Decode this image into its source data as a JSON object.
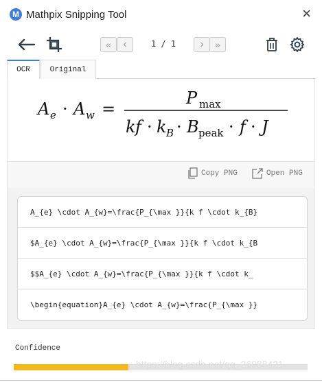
{
  "window": {
    "title": "Mathpix Snipping Tool",
    "close_glyph": "×"
  },
  "toolbar": {
    "back_icon": "arrow-left-icon",
    "crop_icon": "screen-capture-icon",
    "first_page_glyph": "«",
    "prev_page_glyph": "‹",
    "next_page_glyph": "›",
    "last_page_glyph": "»",
    "page_indicator": "1 / 1",
    "delete_icon": "trash-icon",
    "settings_icon": "gear-icon"
  },
  "tabs": [
    {
      "label": "OCR",
      "active": true
    },
    {
      "label": "Original",
      "active": false
    }
  ],
  "preview": {
    "lhs": {
      "A1": "A",
      "e": "e",
      "A2": "A",
      "w": "w",
      "dot": "·",
      "eq": "="
    },
    "numerator": {
      "P": "P",
      "max": "max"
    },
    "denominator": {
      "k": "k",
      "f": "f",
      "dot": "·",
      "k2": "k",
      "B": "B",
      "B2": "B",
      "peak": "peak",
      "f2": "f",
      "J": "J"
    }
  },
  "copy_actions": {
    "copy_png": "Copy PNG",
    "open_png": "Open PNG"
  },
  "results": [
    "A_{e} \\cdot A_{w}=\\frac{P_{\\max }}{k f \\cdot k_{B}",
    "$A_{e} \\cdot A_{w}=\\frac{P_{\\max }}{k f \\cdot k_{B",
    "$$A_{e} \\cdot A_{w}=\\frac{P_{\\max }}{k f \\cdot k_",
    "\\begin{equation}A_{e} \\cdot A_{w}=\\frac{P_{\\max }}"
  ],
  "confidence": {
    "label": "Confidence",
    "value": 0.39,
    "bar_color": "#f2b81c",
    "watermark": "https://blog.csdn.net/qq_26988421"
  },
  "colors": {
    "accent": "#3d7ede",
    "icon": "#2f3d46"
  }
}
